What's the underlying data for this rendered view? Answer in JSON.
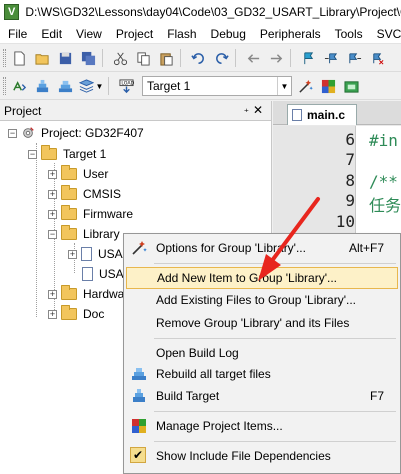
{
  "window": {
    "title": "D:\\WS\\GD32\\Lessons\\day04\\Code\\03_GD32_USART_Library\\Project\\GD",
    "app_icon_letter": "V"
  },
  "menubar": {
    "items": [
      "File",
      "Edit",
      "View",
      "Project",
      "Flash",
      "Debug",
      "Peripherals",
      "Tools",
      "SVCS"
    ]
  },
  "toolbar2": {
    "target_label": "Target 1"
  },
  "project_panel": {
    "title": "Project",
    "pin_glyph": "₊",
    "close_glyph": "✕",
    "project_label": "Project: GD32F407",
    "target_label": "Target 1",
    "groups": [
      "User",
      "CMSIS",
      "Firmware",
      "Library",
      "Hardware",
      "Doc"
    ],
    "library_files": [
      "USA",
      "USA"
    ],
    "hardware_partial": "Hardwa"
  },
  "editor": {
    "tab_label": "main.c",
    "line_numbers": [
      "6",
      "7",
      "8",
      "9",
      "10"
    ],
    "code_lines": [
      "#in",
      "",
      "/**",
      "任务",
      ""
    ]
  },
  "context_menu": {
    "items": [
      {
        "label": "Options for Group 'Library'...",
        "shortcut": "Alt+F7",
        "icon": "options-wand-icon"
      },
      {
        "label": "Add New  Item to Group 'Library'...",
        "shortcut": "",
        "icon": "",
        "highlighted": true
      },
      {
        "label": "Add Existing Files to Group 'Library'...",
        "shortcut": "",
        "icon": ""
      },
      {
        "label": "Remove Group 'Library' and its Files",
        "shortcut": "",
        "icon": ""
      },
      {
        "label": "Open Build Log",
        "shortcut": "",
        "icon": ""
      },
      {
        "label": "Rebuild all target files",
        "shortcut": "",
        "icon": "rebuild-icon"
      },
      {
        "label": "Build Target",
        "shortcut": "F7",
        "icon": "build-icon"
      },
      {
        "label": "Manage Project Items...",
        "shortcut": "",
        "icon": "manage-items-icon"
      },
      {
        "label": "Show Include File Dependencies",
        "shortcut": "",
        "icon": "checkmark-icon",
        "checked": true
      }
    ]
  },
  "colors": {
    "highlight_bg": "#fdf1c8",
    "highlight_border": "#e8b74d",
    "arrow": "#e8261e",
    "comment_green": "#2e8b57"
  }
}
